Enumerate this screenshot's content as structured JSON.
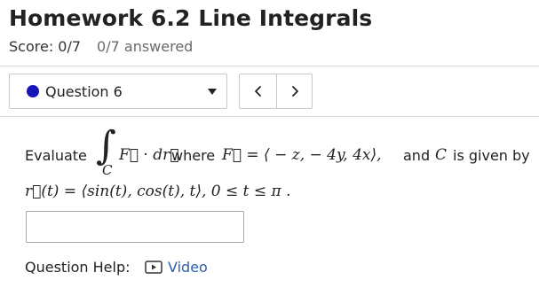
{
  "assignment": {
    "title": "Homework 6.2 Line Integrals",
    "score": "Score: 0/7",
    "answered": "0/7 answered"
  },
  "question_nav": {
    "selected": "Question 6",
    "status_color": "#1616b8",
    "prev_glyph": "<",
    "next_glyph": ">"
  },
  "problem": {
    "evaluate": "Evaluate",
    "integral_sign": "∫",
    "integral_subscript": "C",
    "integrand": "F⃗ · dr⃗",
    "where": "where",
    "field_eq": "F⃗ = ⟨ − z,  − 4y, 4x⟩,",
    "and": "and",
    "C": "C",
    "given_by": "is given by",
    "curve": "r⃗(t) = ⟨sin(t), cos(t), t⟩,  0 ≤ t ≤ π  ."
  },
  "answer": {
    "value": "",
    "placeholder": ""
  },
  "help": {
    "label": "Question Help:",
    "video_label": "Video",
    "video_icon": "play-video-icon",
    "link_color": "#2d5db5"
  }
}
